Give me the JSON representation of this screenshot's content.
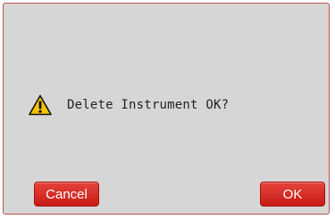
{
  "dialog": {
    "message": "Delete Instrument OK?",
    "icon": "warning-icon",
    "cancel_label": "Cancel",
    "ok_label": "OK"
  },
  "colors": {
    "dialog_background": "#d6d6d6",
    "border": "#c0504d",
    "button": "#d9302a",
    "warning_yellow": "#f5c400"
  }
}
